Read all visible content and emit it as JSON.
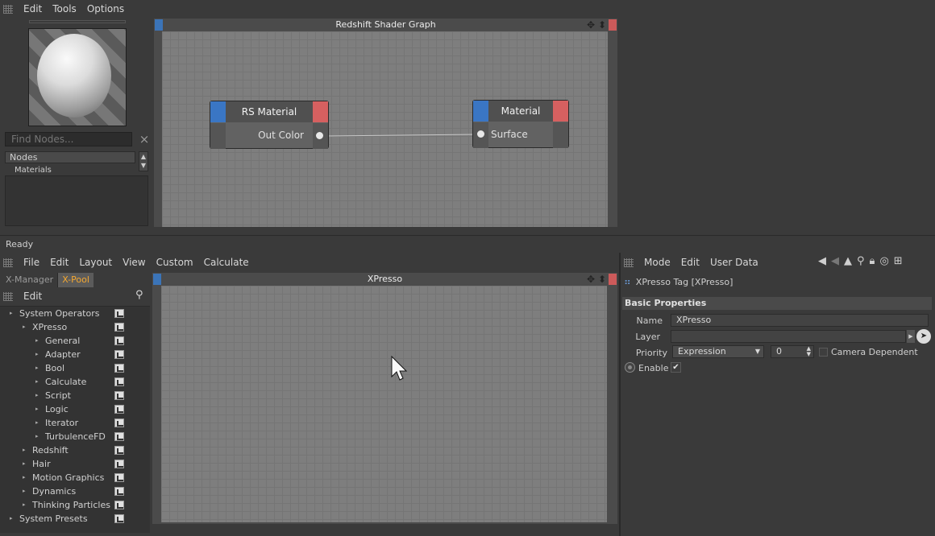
{
  "top_menu": {
    "edit": "Edit",
    "tools": "Tools",
    "options": "Options"
  },
  "material_panel": {
    "find_placeholder": "Find Nodes...",
    "clear": "×",
    "nodes_header": "Nodes",
    "nodes_first_item": "Materials",
    "scroll_up": "▲",
    "scroll_down": "▼"
  },
  "shader_graph": {
    "title": "Redshift Shader Graph",
    "move_icon": "✥",
    "arrow_icon": "⬍",
    "nodes": [
      {
        "title": "RS Material",
        "port": "Out Color"
      },
      {
        "title": "Material",
        "port": "Surface"
      }
    ]
  },
  "status": {
    "text": "Ready"
  },
  "xpresso_menu": {
    "file": "File",
    "edit": "Edit",
    "layout": "Layout",
    "view": "View",
    "custom": "Custom",
    "calculate": "Calculate"
  },
  "tabs": {
    "manager": "X-Manager",
    "pool": "X-Pool"
  },
  "xpool": {
    "edit": "Edit",
    "tree": [
      {
        "label": "System Operators",
        "level": 0
      },
      {
        "label": "XPresso",
        "level": 1
      },
      {
        "label": "General",
        "level": 2
      },
      {
        "label": "Adapter",
        "level": 2
      },
      {
        "label": "Bool",
        "level": 2
      },
      {
        "label": "Calculate",
        "level": 2
      },
      {
        "label": "Script",
        "level": 2
      },
      {
        "label": "Logic",
        "level": 2
      },
      {
        "label": "Iterator",
        "level": 2
      },
      {
        "label": "TurbulenceFD",
        "level": 2
      },
      {
        "label": "Redshift",
        "level": 1
      },
      {
        "label": "Hair",
        "level": 1
      },
      {
        "label": "Motion Graphics",
        "level": 1
      },
      {
        "label": "Dynamics",
        "level": 1
      },
      {
        "label": "Thinking Particles",
        "level": 1
      },
      {
        "label": "System Presets",
        "level": 0
      }
    ]
  },
  "xpresso_editor": {
    "title": "XPresso"
  },
  "attribute_manager": {
    "mode": "Mode",
    "edit": "Edit",
    "user_data": "User Data",
    "object_title": "XPresso Tag [XPresso]",
    "section": "Basic Properties",
    "name_label": "Name",
    "name_value": "XPresso",
    "layer_label": "Layer",
    "layer_value": "",
    "priority_label": "Priority",
    "priority_value": "Expression",
    "priority_number": "0",
    "camera_dependent": "Camera Dependent",
    "enable_label": "Enable",
    "enable_check": "✔"
  }
}
